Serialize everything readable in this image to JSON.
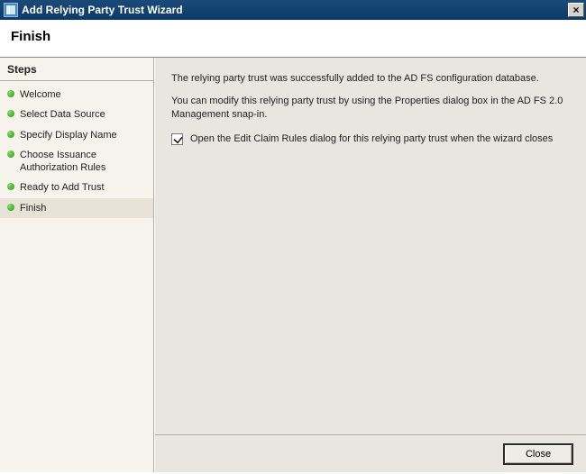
{
  "window": {
    "title": "Add Relying Party Trust Wizard",
    "close_label": "×"
  },
  "page": {
    "heading": "Finish"
  },
  "sidebar": {
    "header": "Steps",
    "items": [
      {
        "label": "Welcome"
      },
      {
        "label": "Select Data Source"
      },
      {
        "label": "Specify Display Name"
      },
      {
        "label": "Choose Issuance Authorization Rules"
      },
      {
        "label": "Ready to Add Trust"
      },
      {
        "label": "Finish"
      }
    ],
    "current_index": 5
  },
  "content": {
    "line1": "The relying party trust was successfully added to the AD FS configuration database.",
    "line2": "You can modify this relying party trust by using the Properties dialog box in the AD FS 2.0 Management snap-in.",
    "checkbox_label": "Open the Edit Claim Rules dialog for this relying party trust when the wizard closes",
    "checkbox_checked": true
  },
  "footer": {
    "close_label": "Close"
  }
}
